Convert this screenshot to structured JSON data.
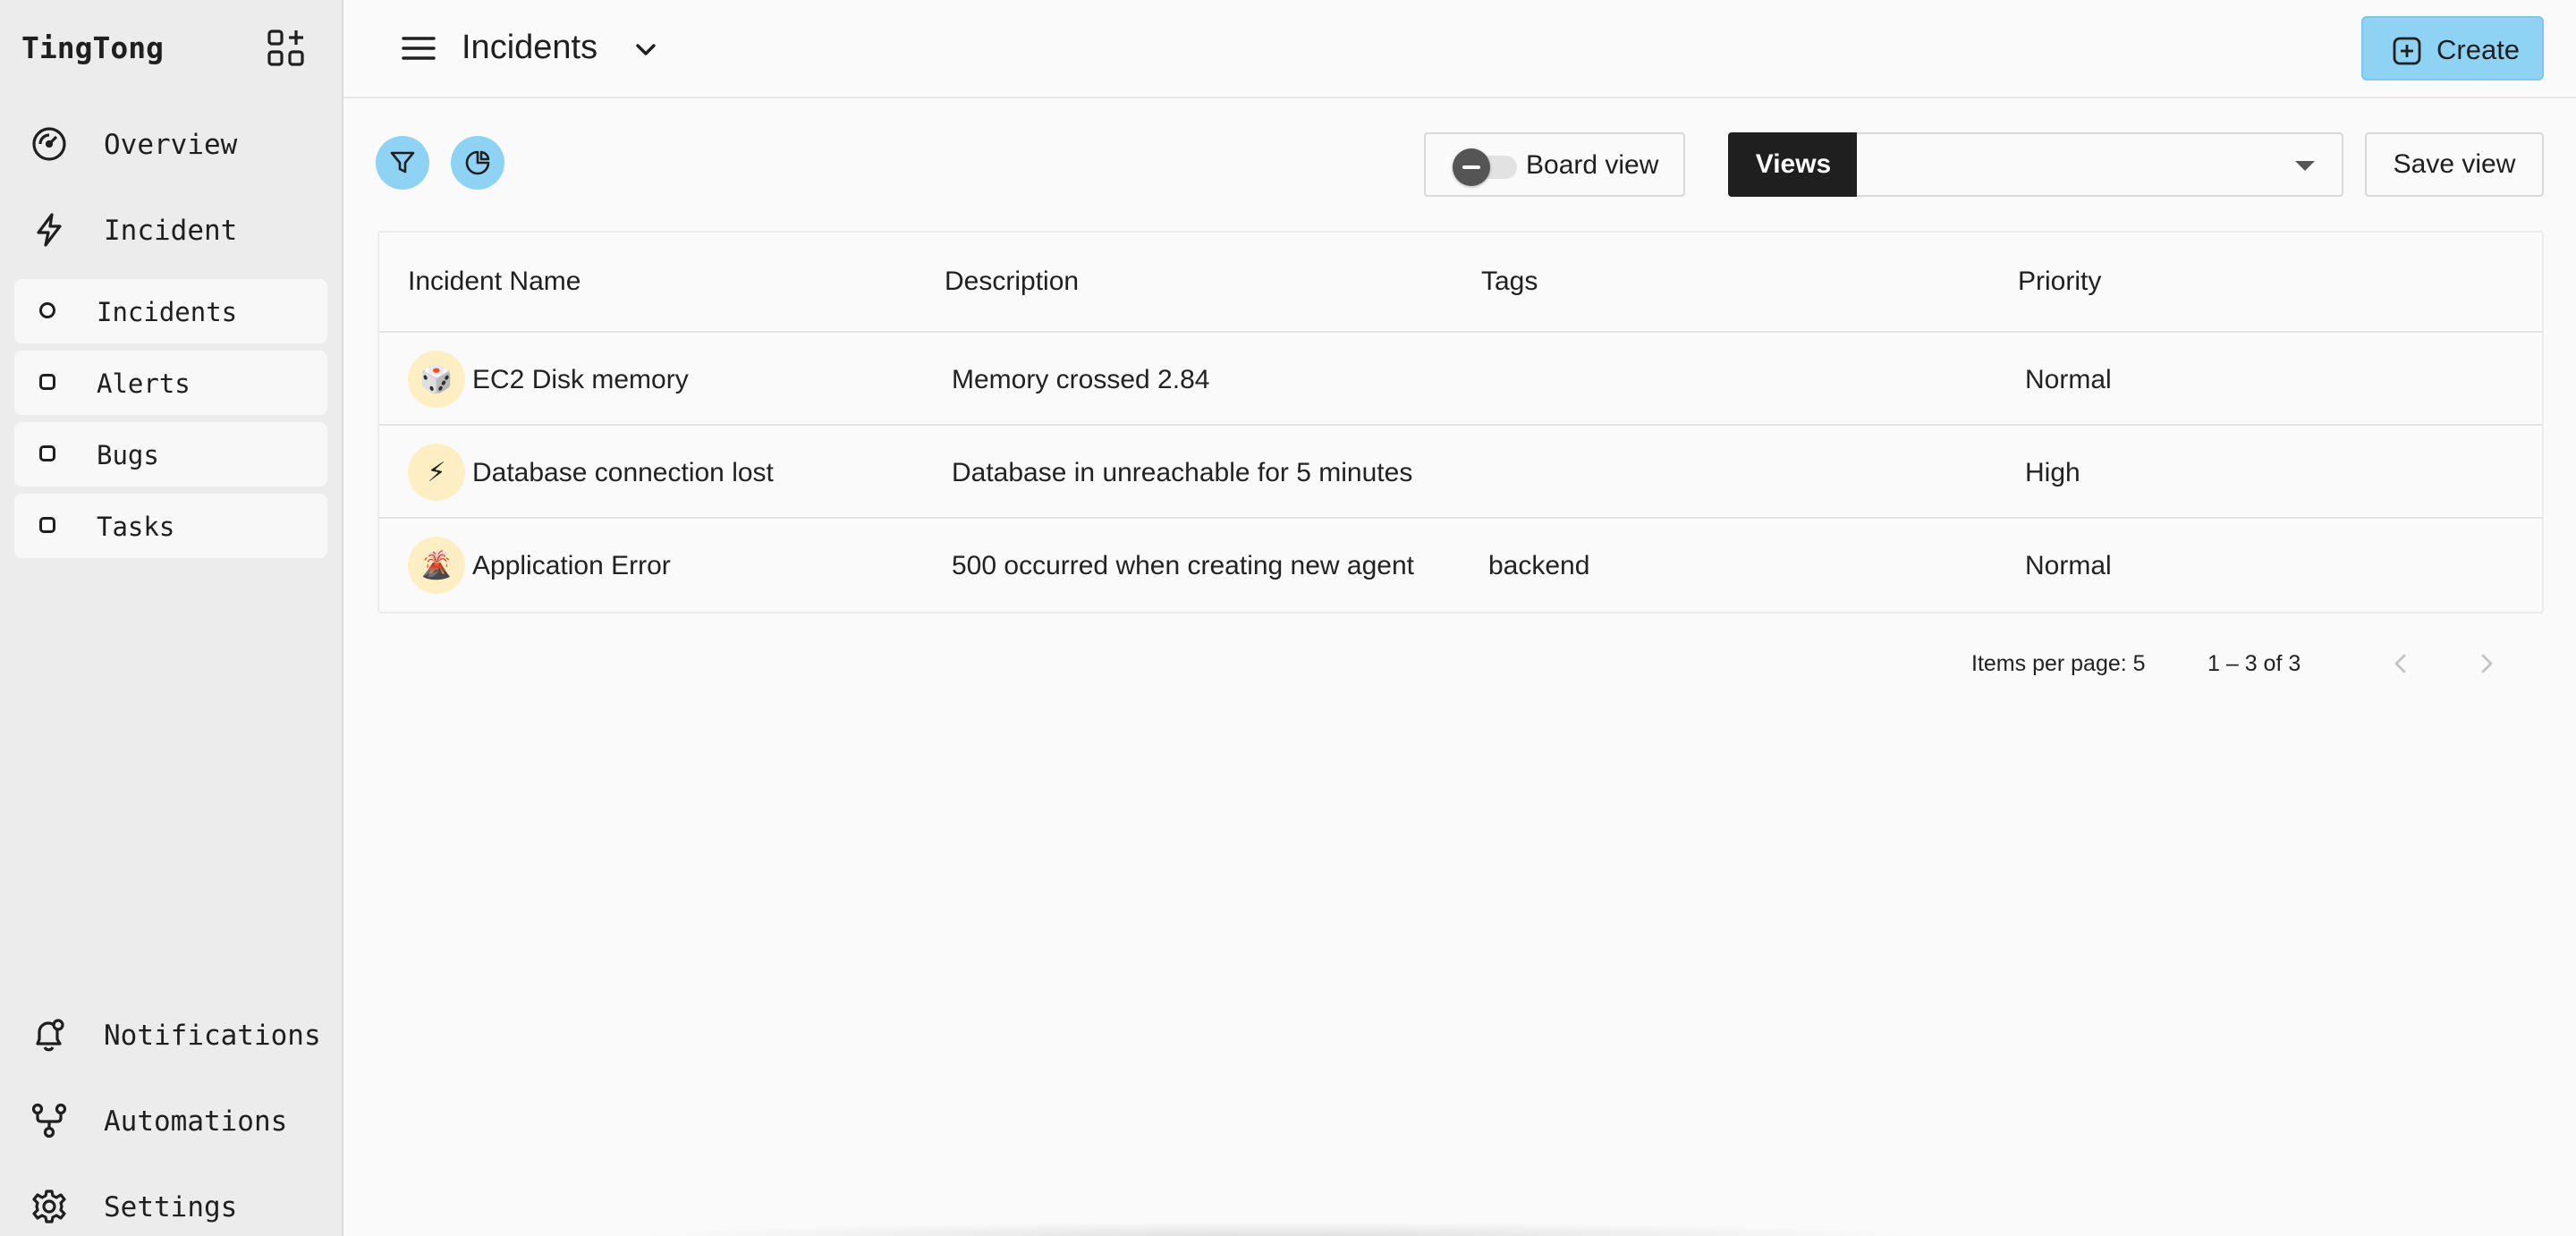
{
  "app": {
    "brand": "TingTong"
  },
  "sidebar": {
    "top_items": [
      {
        "label": "Overview",
        "icon": "gauge-icon"
      },
      {
        "label": "Incident",
        "icon": "bolt-icon"
      }
    ],
    "sub_items": [
      {
        "label": "Incidents",
        "icon": "circle-dot-icon"
      },
      {
        "label": "Alerts",
        "icon": "square-dot-icon"
      },
      {
        "label": "Bugs",
        "icon": "square-dot-icon"
      },
      {
        "label": "Tasks",
        "icon": "square-dot-icon"
      }
    ],
    "bottom_items": [
      {
        "label": "Notifications",
        "icon": "bell-icon"
      },
      {
        "label": "Automations",
        "icon": "workflow-icon"
      },
      {
        "label": "Settings",
        "icon": "gear-icon"
      }
    ]
  },
  "header": {
    "title": "Incidents",
    "create_label": "Create"
  },
  "toolbar": {
    "board_view_label": "Board view",
    "board_view_on": false,
    "views_label": "Views",
    "views_selected": "",
    "save_view_label": "Save view"
  },
  "table": {
    "columns": [
      "Incident Name",
      "Description",
      "Tags",
      "Priority"
    ],
    "rows": [
      {
        "emoji": "🎲",
        "name": "EC2 Disk memory",
        "description": "Memory crossed 2.84",
        "tags": "",
        "priority": "Normal"
      },
      {
        "emoji": "⚡",
        "name": "Database connection lost",
        "description": "Database in unreachable for 5 minutes",
        "tags": "",
        "priority": "High"
      },
      {
        "emoji": "🌋",
        "name": "Application Error",
        "description": "500 occurred when creating new agent",
        "tags": "backend",
        "priority": "Normal"
      }
    ]
  },
  "pagination": {
    "items_per_page_label": "Items per page: 5",
    "range_label": "1 – 3 of 3"
  },
  "colors": {
    "accent": "#8fd3f4",
    "sidebar_bg": "#ececec",
    "dark": "#1f1f1f"
  }
}
